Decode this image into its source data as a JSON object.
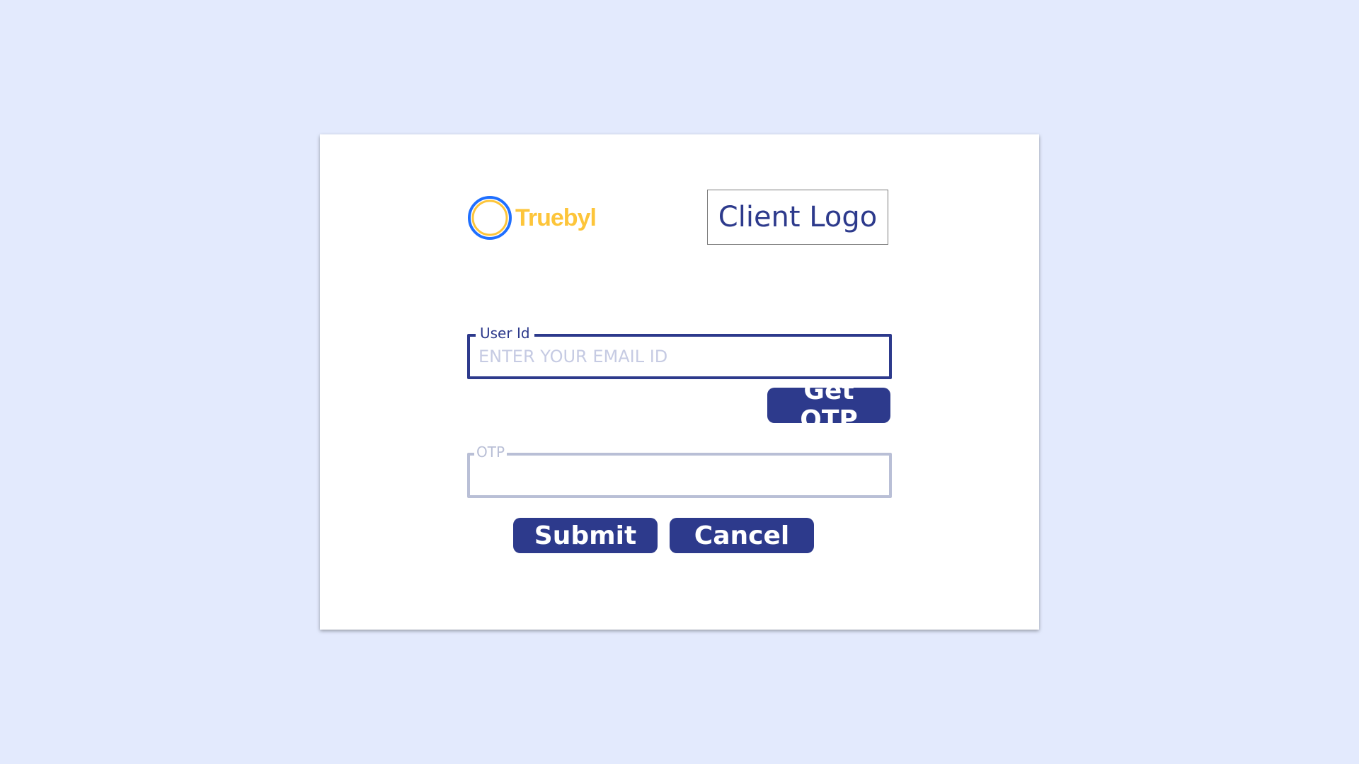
{
  "brand": {
    "name": "Truebyl",
    "icon": "ring-logo-icon",
    "colors": {
      "ring_outer": "#1f6fff",
      "ring_inner": "#fdc53a",
      "text": "#fdc53a"
    }
  },
  "client_logo": {
    "text": "Client Logo"
  },
  "form": {
    "user_id": {
      "label": "User Id",
      "value": "",
      "placeholder": "ENTER YOUR EMAIL ID"
    },
    "get_otp_label": "Get OTP",
    "otp": {
      "label": "OTP",
      "value": "",
      "placeholder": ""
    },
    "submit_label": "Submit",
    "cancel_label": "Cancel"
  },
  "colors": {
    "background": "#e3eafd",
    "card": "#ffffff",
    "primary": "#2d3a8c",
    "inactive_border": "#b9bfd6",
    "placeholder": "#c6cbe3"
  }
}
